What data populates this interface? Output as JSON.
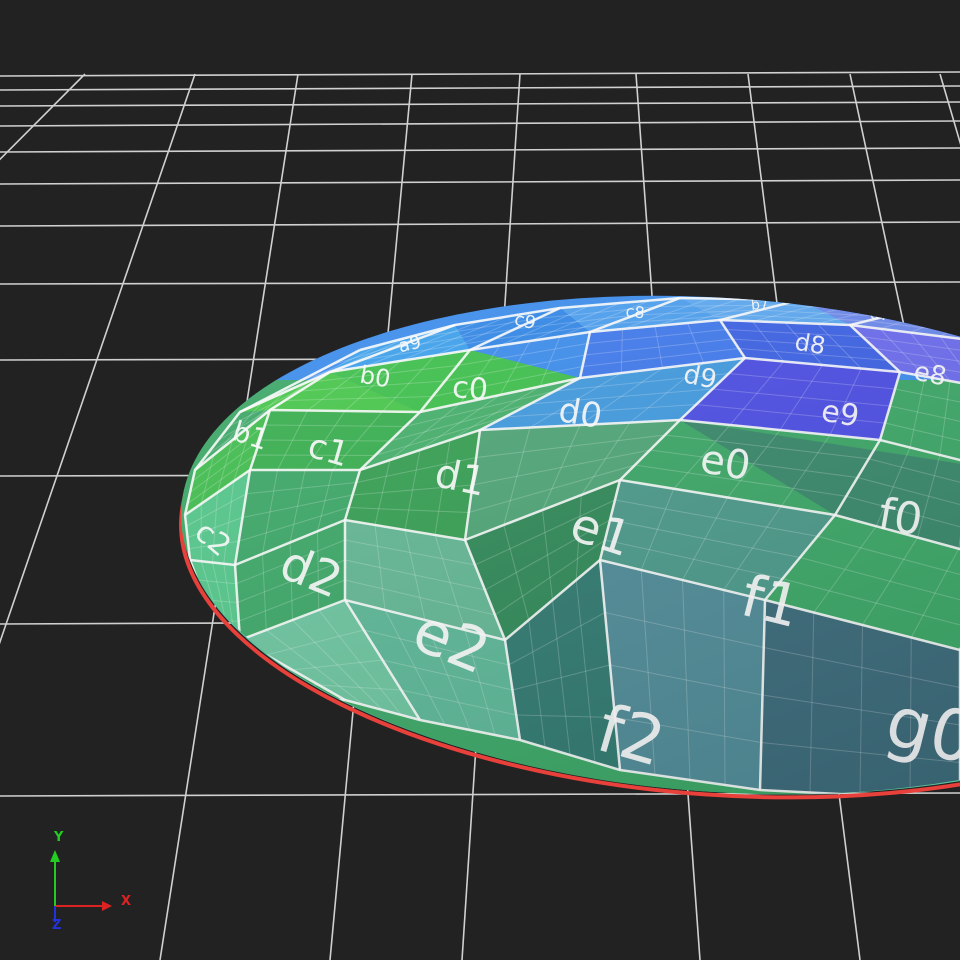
{
  "viewport": {
    "background_color": "#222222",
    "grid_color": "#d0d0d0",
    "rim_color": "#e8403a"
  },
  "disc": {
    "label_color": "#ffffff",
    "cells": [
      {
        "label": "b0",
        "color": "#46c84a"
      },
      {
        "label": "b1",
        "color": "#3fbe4d"
      },
      {
        "label": "c2",
        "color": "#52c88a"
      },
      {
        "label": "c0",
        "color": "#3cc14a"
      },
      {
        "label": "c1",
        "color": "#36b04e"
      },
      {
        "label": "d2",
        "color": "#3aa866"
      },
      {
        "label": "c9",
        "color": "#2f86e8"
      },
      {
        "label": "c8",
        "color": "#4a9ef0"
      },
      {
        "label": "d0",
        "color": "#43b06a"
      },
      {
        "label": "d1",
        "color": "#34a052"
      },
      {
        "label": "e2",
        "color": "#62b894"
      },
      {
        "label": "d9",
        "color": "#3e78ee"
      },
      {
        "label": "d8",
        "color": "#3a60e6"
      },
      {
        "label": "d7",
        "color": "#6a88ee"
      },
      {
        "label": "e0",
        "color": "#4ea676"
      },
      {
        "label": "e1",
        "color": "#2e8a58"
      },
      {
        "label": "f2",
        "color": "#2f7a70"
      },
      {
        "label": "e9",
        "color": "#4a4ce6"
      },
      {
        "label": "e8",
        "color": "#6a6af0"
      },
      {
        "label": "f0",
        "color": "#37886a"
      },
      {
        "label": "f1",
        "color": "#4a9a8a"
      },
      {
        "label": "g0",
        "color": "#3a6a7a"
      },
      {
        "label": "a9",
        "color": "#3aa0ee"
      },
      {
        "label": "b7",
        "color": "#5aa8f2"
      }
    ]
  },
  "axes_gizmo": {
    "y_label": "Y",
    "x_label": "X",
    "z_label": "Z",
    "y_color": "#22cc22",
    "x_color": "#dd2222",
    "z_color": "#2233dd"
  }
}
